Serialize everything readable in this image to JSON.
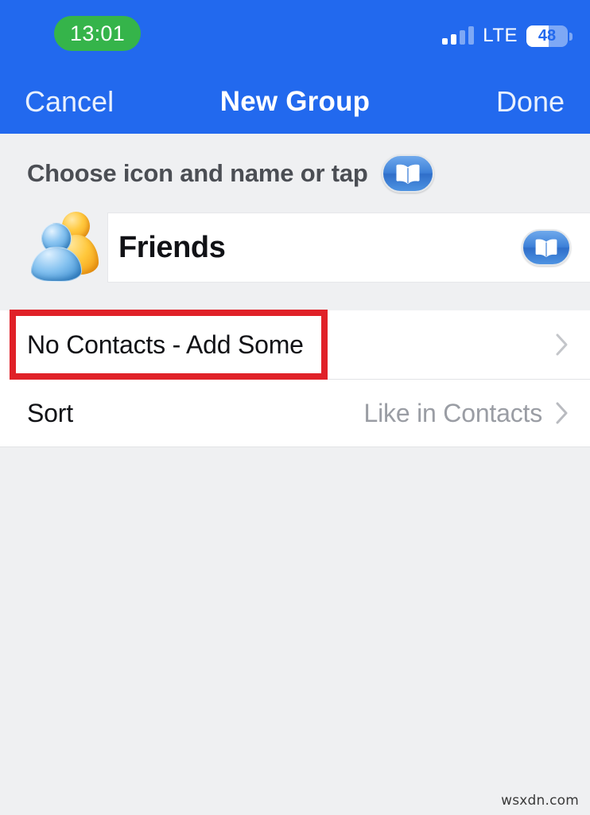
{
  "status_bar": {
    "time": "13:01",
    "network_type": "LTE",
    "battery_percent": "48",
    "battery_level": 48,
    "signal_bars_active": 2,
    "signal_bars_total": 4,
    "time_pill_color": "#35b44a",
    "bar_color": "#2269ee"
  },
  "nav_bar": {
    "cancel_label": "Cancel",
    "title": "New Group",
    "done_label": "Done"
  },
  "choose_section": {
    "label": "Choose icon and name or tap",
    "icon_name": "book-icon"
  },
  "name_field": {
    "avatar_name": "contacts-avatar",
    "value": "Friends",
    "placeholder": "Name",
    "trailing_icon_name": "book-icon"
  },
  "list": {
    "rows": [
      {
        "label": "No Contacts - Add Some",
        "value": "",
        "has_chevron": true,
        "highlighted": true
      },
      {
        "label": "Sort",
        "value": "Like in Contacts",
        "has_chevron": true,
        "highlighted": false
      }
    ]
  },
  "annotation": {
    "color": "#e02128",
    "target": "No Contacts - Add Some"
  },
  "watermark": {
    "text": "wsxdn.com"
  }
}
